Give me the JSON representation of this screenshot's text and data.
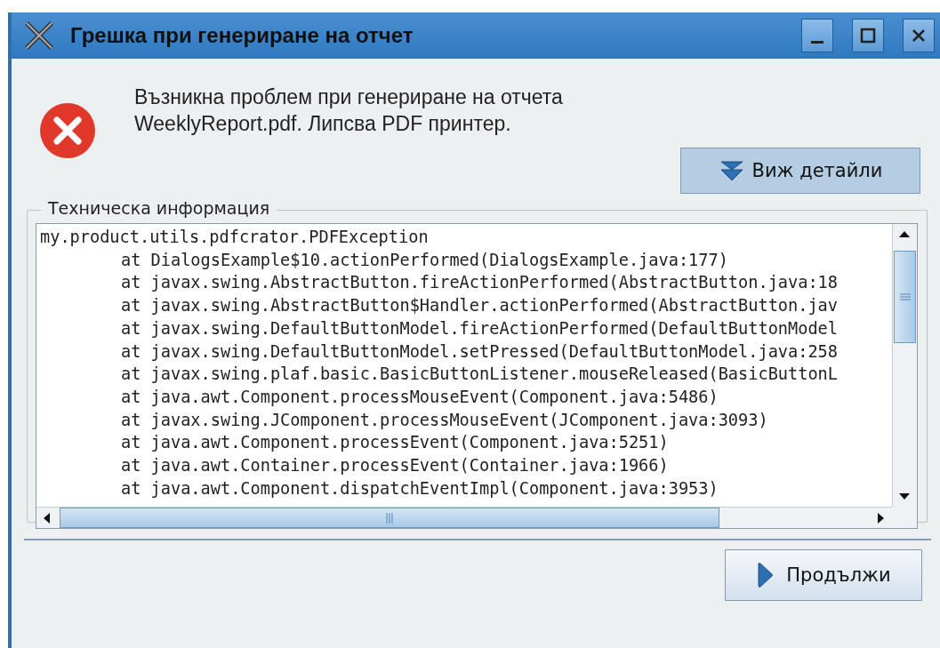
{
  "window": {
    "title": "Грешка при генериране на отчет"
  },
  "message": "Възникна проблем при генериране на отчета WeeklyReport.pdf. Липсва PDF принтер.",
  "details_button": "Виж детайли",
  "technical_info": {
    "legend": "Техническа информация",
    "exception": "my.product.utils.pdfcrator.PDFException",
    "frames": [
      "at DialogsExample$10.actionPerformed(DialogsExample.java:177)",
      "at javax.swing.AbstractButton.fireActionPerformed(AbstractButton.java:18",
      "at javax.swing.AbstractButton$Handler.actionPerformed(AbstractButton.jav",
      "at javax.swing.DefaultButtonModel.fireActionPerformed(DefaultButtonModel",
      "at javax.swing.DefaultButtonModel.setPressed(DefaultButtonModel.java:258",
      "at javax.swing.plaf.basic.BasicButtonListener.mouseReleased(BasicButtonL",
      "at java.awt.Component.processMouseEvent(Component.java:5486)",
      "at javax.swing.JComponent.processMouseEvent(JComponent.java:3093)",
      "at java.awt.Component.processEvent(Component.java:5251)",
      "at java.awt.Container.processEvent(Container.java:1966)",
      "at java.awt.Component.dispatchEventImpl(Component.java:3953)"
    ]
  },
  "continue_button": "Продължи"
}
